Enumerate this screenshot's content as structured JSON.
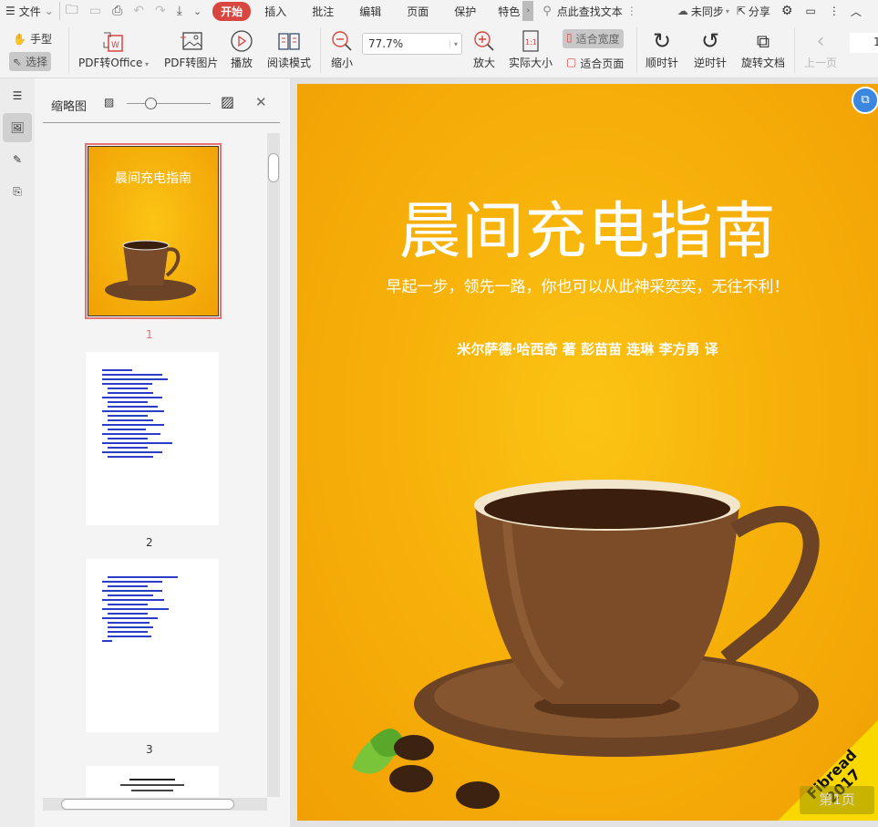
{
  "tabbar": {
    "menu_label": "文件",
    "tabs": [
      "开始",
      "插入",
      "批注",
      "编辑",
      "页面",
      "保护",
      "特色"
    ],
    "active_tab": "开始",
    "search_placeholder": "点此查找文本",
    "sync": "未同步",
    "share": "分享"
  },
  "toolbar": {
    "hand": "手型",
    "select": "选择",
    "pdf_to_office": "PDF转Office",
    "pdf_to_image": "PDF转图片",
    "play": "播放",
    "read_mode": "阅读模式",
    "zoom_out": "缩小",
    "zoom_value": "77.7%",
    "zoom_in": "放大",
    "actual_size": "实际大小",
    "fit_width": "适合宽度",
    "fit_page": "适合页面",
    "clockwise": "顺时针",
    "counterclockwise": "逆时针",
    "rotate_doc": "旋转文档",
    "prev_page": "上一页",
    "page_input": "1"
  },
  "panel": {
    "title": "缩略图",
    "pages": [
      "1",
      "2",
      "3"
    ]
  },
  "document": {
    "title": "晨间充电指南",
    "subtitle": "早起一步，领先一路，你也可以从此神采奕奕，无往不利！",
    "authors": "米尔萨德·哈西奇 著 彭苗苗 连琳 李方勇 译",
    "badge": "Fibread 2017",
    "page_indicator": "第1页"
  },
  "colors": {
    "accent": "#d9453f",
    "page_bg": "#f7b10a",
    "thumb_select": "#e57373"
  }
}
